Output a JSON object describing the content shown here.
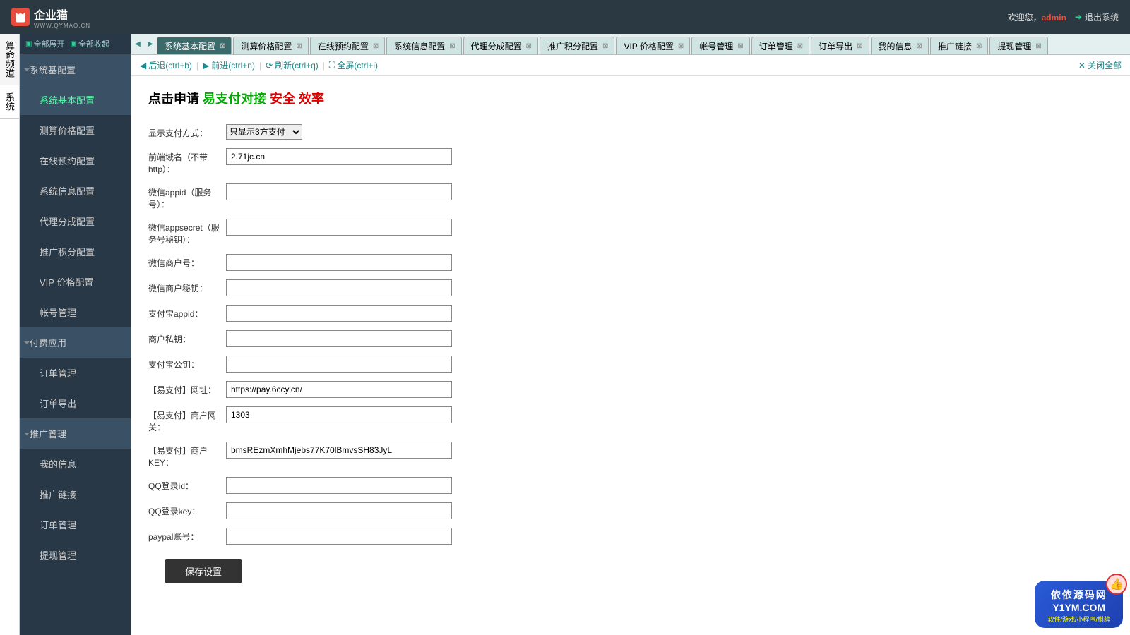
{
  "header": {
    "brand_name": "企业猫",
    "brand_sub": "WWW.QYMAO.CN",
    "welcome_prefix": "欢迎您，",
    "username": "admin",
    "logout": "退出系统"
  },
  "side_tabs": [
    {
      "label": "算命频道"
    },
    {
      "label": "系统"
    }
  ],
  "sidebar_tools": {
    "expand_all": "全部展开",
    "collapse_all": "全部收起"
  },
  "sidebar": [
    {
      "type": "cat",
      "label": "系统基配置",
      "open": true
    },
    {
      "type": "item",
      "label": "系统基本配置",
      "active": true
    },
    {
      "type": "item",
      "label": "测算价格配置"
    },
    {
      "type": "item",
      "label": "在线预约配置"
    },
    {
      "type": "item",
      "label": "系统信息配置"
    },
    {
      "type": "item",
      "label": "代理分成配置"
    },
    {
      "type": "item",
      "label": "推广积分配置"
    },
    {
      "type": "item",
      "label": "VIP 价格配置"
    },
    {
      "type": "item",
      "label": "帐号管理"
    },
    {
      "type": "cat",
      "label": "付费应用",
      "open": true
    },
    {
      "type": "item",
      "label": "订单管理"
    },
    {
      "type": "item",
      "label": "订单导出"
    },
    {
      "type": "cat",
      "label": "推广管理",
      "open": true
    },
    {
      "type": "item",
      "label": "我的信息"
    },
    {
      "type": "item",
      "label": "推广链接"
    },
    {
      "type": "item",
      "label": "订单管理"
    },
    {
      "type": "item",
      "label": "提现管理"
    }
  ],
  "tabs": [
    {
      "label": "系统基本配置",
      "active": true
    },
    {
      "label": "测算价格配置"
    },
    {
      "label": "在线预约配置"
    },
    {
      "label": "系统信息配置"
    },
    {
      "label": "代理分成配置"
    },
    {
      "label": "推广积分配置"
    },
    {
      "label": "VIP 价格配置"
    },
    {
      "label": "帐号管理"
    },
    {
      "label": "订单管理"
    },
    {
      "label": "订单导出"
    },
    {
      "label": "我的信息"
    },
    {
      "label": "推广链接"
    },
    {
      "label": "提现管理"
    }
  ],
  "navbar": {
    "back": "后退(ctrl+b)",
    "forward": "前进(ctrl+n)",
    "refresh": "刷新(ctrl+q)",
    "fullscreen": "全屏(ctrl+i)",
    "close_all": "关闭全部"
  },
  "page": {
    "t1": "点击申请 ",
    "t2": "易支付对接 ",
    "t3": "安全 ",
    "t4": "效率"
  },
  "form": {
    "pay_display_label": "显示支付方式：",
    "pay_display_value": "只显示3方支付",
    "domain_label": "前端域名（不带http）：",
    "domain_value": "2.71jc.cn",
    "wx_appid_label": "微信appid（服务号）：",
    "wx_appid_value": "",
    "wx_secret_label": "微信appsecret（服务号秘钥）：",
    "wx_secret_value": "",
    "wx_mch_label": "微信商户号：",
    "wx_mch_value": "",
    "wx_mchkey_label": "微信商户秘钥：",
    "wx_mchkey_value": "",
    "ali_appid_label": "支付宝appid：",
    "ali_appid_value": "",
    "mch_private_label": "商户私钥：",
    "mch_private_value": "",
    "ali_pubkey_label": "支付宝公钥：",
    "ali_pubkey_value": "",
    "epay_url_label": "【易支付】网址：",
    "epay_url_value": "https://pay.6ccy.cn/",
    "epay_gw_label": "【易支付】商户网关：",
    "epay_gw_value": "1303",
    "epay_key_label": "【易支付】商户KEY：",
    "epay_key_value": "bmsREzmXmhMjebs77K70lBmvsSH83JyL",
    "qq_id_label": "QQ登录id：",
    "qq_id_value": "",
    "qq_key_label": "QQ登录key：",
    "qq_key_value": "",
    "paypal_label": "paypal账号：",
    "paypal_value": "",
    "save_btn": "保存设置"
  },
  "watermark": {
    "title": "依依源码网",
    "domain": "Y1YM.COM",
    "sub": "软件/游戏/小程序/棋牌"
  }
}
